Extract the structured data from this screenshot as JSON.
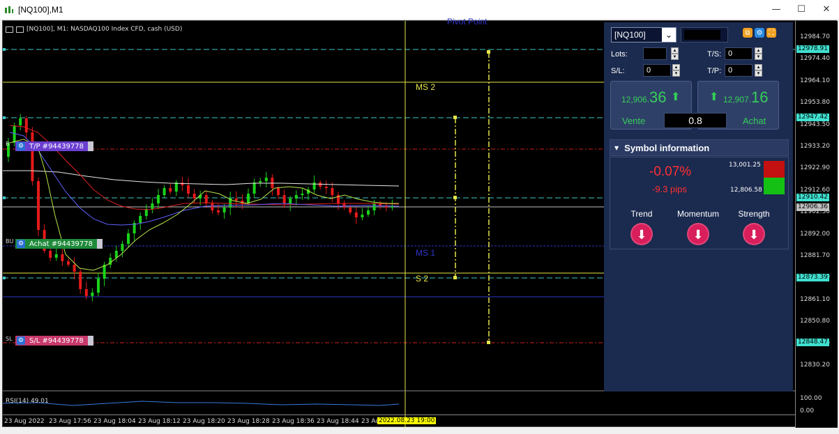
{
  "window": {
    "title": "[NQ100],M1",
    "minimize": "—",
    "maximize": "☐",
    "close": "✕"
  },
  "chart": {
    "title": "[NQ100], M1:  NASDAQ100 Index CFD, cash (USD)",
    "levels": {
      "ms2": "MS 2",
      "ms1": "MS 1",
      "s2": "S 2",
      "pivot_top": "Pivot Point"
    },
    "orders": {
      "tp": "T/P #94439778",
      "buy": "Achat #94439778",
      "sl": "S/L #94439778",
      "tp_mark": "B",
      "buy_mark": "BU",
      "sl_mark": "SL"
    },
    "rsi_label": "RSI(14) 49.01",
    "rsi_scale": [
      "100.00",
      "0.00"
    ],
    "price_ticks": [
      "12984.70",
      "12974.40",
      "12964.10",
      "12953.80",
      "12943.50",
      "12933.20",
      "12922.90",
      "12912.60",
      "12902.30",
      "12892.00",
      "12881.70",
      "12871.40",
      "12861.10",
      "12850.80",
      "12840.50",
      "12830.20"
    ],
    "price_tags": [
      {
        "text": "12978.91",
        "color": "#40e0d0"
      },
      {
        "text": "12947.42",
        "color": "#40e0d0"
      },
      {
        "text": "12910.42",
        "color": "#40e0d0"
      },
      {
        "text": "12906.36",
        "color": "#c0c0c0"
      },
      {
        "text": "12873.39",
        "color": "#40e0d0"
      },
      {
        "text": "12848.47",
        "color": "#40e0d0"
      }
    ],
    "time_ticks": [
      "23 Aug 2022",
      "23 Aug 17:56",
      "23 Aug 18:04",
      "23 Aug 18:12",
      "23 Aug 18:20",
      "23 Aug 18:28",
      "23 Aug 18:36",
      "23 Aug 18:44",
      "23 Au"
    ],
    "time_highlight": "2022.08.23 19:00"
  },
  "panel": {
    "symbol": "[NQ100]",
    "lots_label": "Lots:",
    "ts_label": "T/S:",
    "ts_value": "0",
    "sl_label": "S/L:",
    "sl_value": "0",
    "tp_label": "T/P:",
    "tp_value": "0",
    "sell": {
      "small": "12,906.",
      "big": "36",
      "caption": "Vente"
    },
    "buy": {
      "small": "12,907.",
      "big": "16",
      "caption": "Achat"
    },
    "spread": "0.8",
    "section_title": "Symbol information",
    "change_pct": "-0.07%",
    "change_pips": "-9.3 pips",
    "high": "13,001.25",
    "low": "12,806.58",
    "indicators": [
      {
        "label": "Trend",
        "direction": "down"
      },
      {
        "label": "Momentum",
        "direction": "down"
      },
      {
        "label": "Strength",
        "direction": "down"
      }
    ],
    "colors": {
      "up": "#34d057",
      "down": "#ff3030",
      "indicator": "#d81e5b"
    }
  }
}
